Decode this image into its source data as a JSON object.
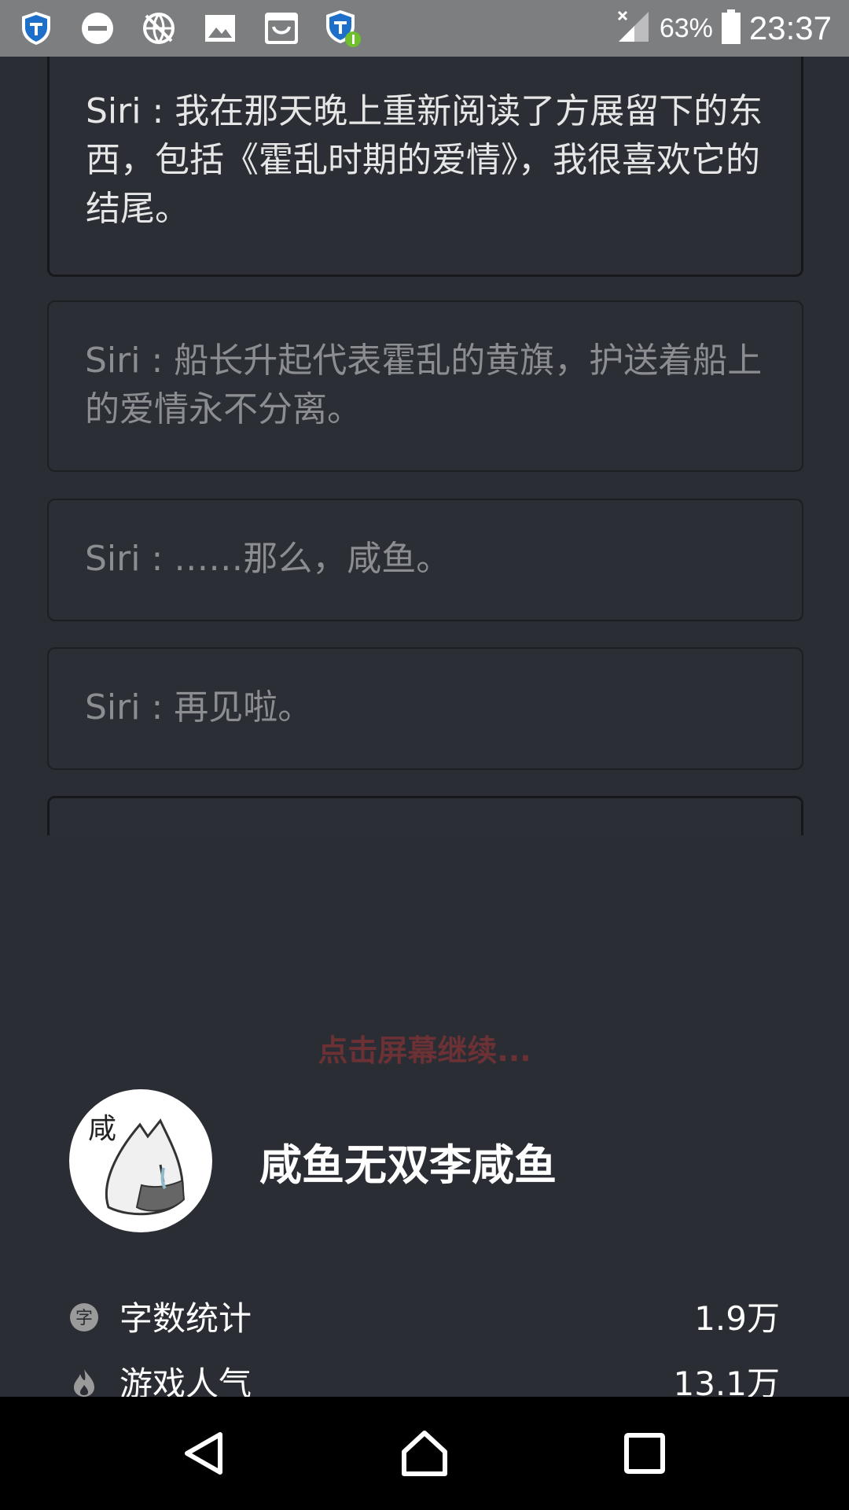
{
  "status_bar": {
    "battery_percent": "63%",
    "time": "23:37",
    "icons": [
      "shield-icon",
      "do-not-disturb-icon",
      "no-network-icon",
      "image-icon",
      "shopping-icon",
      "shield-update-icon"
    ]
  },
  "dialogs": [
    {
      "text": "Siri : 我在那天晚上重新阅读了方展留下的东西，包括《霍乱时期的爱情》，我很喜欢它的结尾。",
      "state": "active"
    },
    {
      "text": "Siri : 船长升起代表霍乱的黄旗，护送着船上的爱情永不分离。",
      "state": "faded"
    },
    {
      "text": "Siri : ……那么，咸鱼。",
      "state": "faded"
    },
    {
      "text": "Siri : 再见啦。",
      "state": "faded"
    },
    {
      "text": "",
      "state": "active"
    }
  ],
  "continue_hint": "点击屏幕继续...",
  "author": {
    "avatar_text": "咸",
    "name": "咸鱼无双李咸鱼"
  },
  "stats": [
    {
      "label": "字数统计",
      "value": "1.9万",
      "icon": "word-count-icon"
    },
    {
      "label": "游戏人气",
      "value": "13.1万",
      "icon": "fire-icon"
    }
  ],
  "colors": {
    "background": "#2a2d33",
    "status_bar": "#7d7e80",
    "hint": "#6b3134",
    "nav_bar": "#000000"
  }
}
